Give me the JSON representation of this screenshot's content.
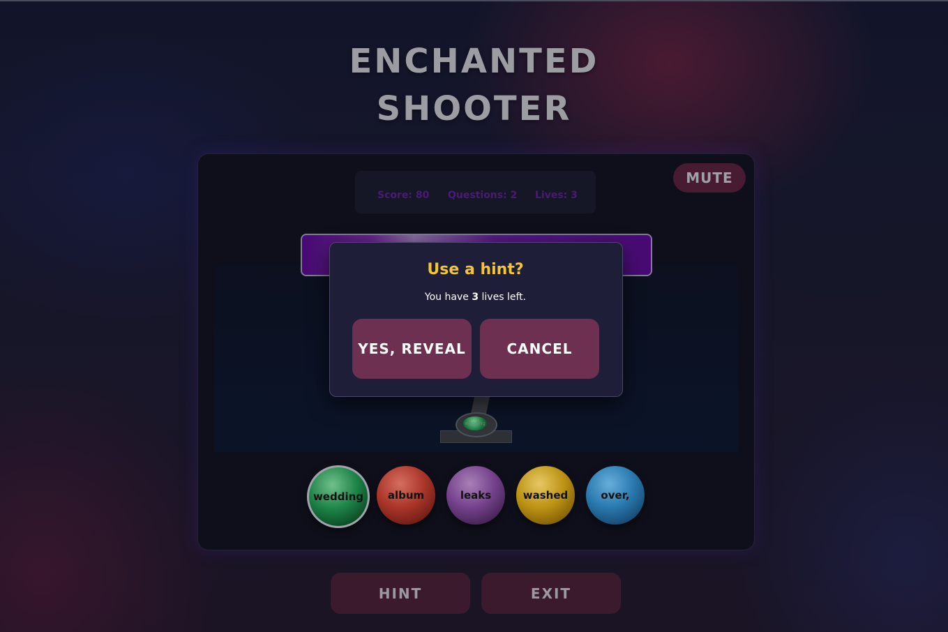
{
  "title": {
    "line1": "ENCHANTED",
    "line2": "SHOOTER"
  },
  "mute_label": "MUTE",
  "stats": {
    "score": "Score: 80",
    "questions": "Questions: 2",
    "lives": "Lives: 3"
  },
  "cannon": {
    "loaded_word": "wedding"
  },
  "balls": [
    {
      "word": "wedding",
      "color": "#1e8a4b"
    },
    {
      "word": "album",
      "color": "#b3382a"
    },
    {
      "word": "leaks",
      "color": "#7a4593"
    },
    {
      "word": "washed",
      "color": "#c79a14"
    },
    {
      "word": "over,",
      "color": "#2b7fb8"
    }
  ],
  "modal": {
    "title": "Use a hint?",
    "text_before": "You have",
    "lives": "3",
    "text_after": "lives left.",
    "yes_label": "YES, REVEAL",
    "cancel_label": "CANCEL"
  },
  "bottom": {
    "hint_label": "HINT",
    "exit_label": "EXIT"
  },
  "colors": {
    "accent_yellow": "#f4c534",
    "button_bg": "#6d3050",
    "stats_text": "#4d1c78"
  }
}
